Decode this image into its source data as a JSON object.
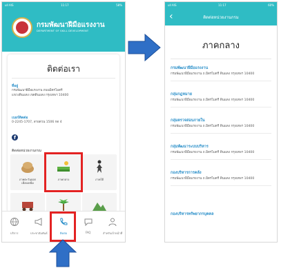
{
  "colors": {
    "accent": "#2fbcc4",
    "link": "#2a8fc9",
    "highlight": "#e32222",
    "arrow": "#2f6fc6"
  },
  "screen1": {
    "status": {
      "carrier": "ull AIS",
      "time": "11:17",
      "battery": "58%"
    },
    "header": {
      "title": "กรมพัฒนาฝีมือแรงงาน",
      "subtitle": "DEPARTMENT OF SKILL DEVELOPMENT"
    },
    "card": {
      "title": "ติดต่อเรา",
      "address_label": "ที่อยู่",
      "address_lines": [
        "กรมพัฒนาฝีมือแรงงาน ถนนมิตรไมตรี",
        "แขวงดินแดง เขตดินแดง กรุงเทพฯ 10400"
      ],
      "phone_label": "เบอร์ติดต่อ",
      "phone_value": "0-2245-1707, สายด่วน 1506 กด 4",
      "units_label": "ติดต่อหน่วยงานกรม",
      "grid": [
        {
          "label_lines": [
            "ภาคตะวันออก",
            "เฉียงเหนือ"
          ],
          "icon": "basket-icon"
        },
        {
          "label_lines": [
            "ภาคกลาง"
          ],
          "icon": "rice-field-icon"
        },
        {
          "label_lines": [
            "ภาคใต้"
          ],
          "icon": "dancer-icon"
        },
        {
          "label_lines": [
            ""
          ],
          "icon": "cart-icon"
        },
        {
          "label_lines": [
            ""
          ],
          "icon": "palm-icon"
        },
        {
          "label_lines": [
            ""
          ],
          "icon": "mountain-icon"
        }
      ]
    },
    "nav": [
      {
        "label": "บริการ",
        "icon": "globe-icon"
      },
      {
        "label": "ประชาสัมพันธ์",
        "icon": "megaphone-icon"
      },
      {
        "label": "ติดต่อ",
        "icon": "phone-icon"
      },
      {
        "label": "FAQ",
        "icon": "chat-icon"
      },
      {
        "label": "สำหรับเจ้าหน้าที่",
        "icon": "user-icon"
      }
    ]
  },
  "screen2": {
    "status": {
      "carrier": "ull AIS",
      "time": "11:17",
      "battery": "60%"
    },
    "header": {
      "title": "ติดต่อหน่วยงานกรม"
    },
    "region_title": "ภาคกลาง",
    "entries": [
      {
        "name": "กรมพัฒนาฝีมือแรงงาน",
        "address": "กรมพัฒนาฝีมือแรงงาน ถ.มิตรไมตรี ดินแดง กรุงเทพฯ 10400"
      },
      {
        "name": "กลุ่มกฎหมาย",
        "address": "กรมพัฒนาฝีมือแรงงาน ถ.มิตรไมตรี ดินแดง กรุงเทพฯ 10400"
      },
      {
        "name": "กลุ่มตรวจสอบภายใน",
        "address": "กรมพัฒนาฝีมือแรงงาน ถ.มิตรไมตรี ดินแดง กรุงเทพฯ 10400"
      },
      {
        "name": "กลุ่มพัฒนาระบบบริหาร",
        "address": "กรมพัฒนาฝีมือแรงงาน ถ.มิตรไมตรี ดินแดง กรุงเทพฯ 10400"
      },
      {
        "name": "กองบริหารการคลัง",
        "address": "กรมพัฒนาฝีมือแรงงาน ถ.มิตรไมตรี ดินแดง กรุงเทพฯ 10400"
      },
      {
        "name": "กองบริหารทรัพยากรบุคคล",
        "address": ""
      }
    ]
  }
}
